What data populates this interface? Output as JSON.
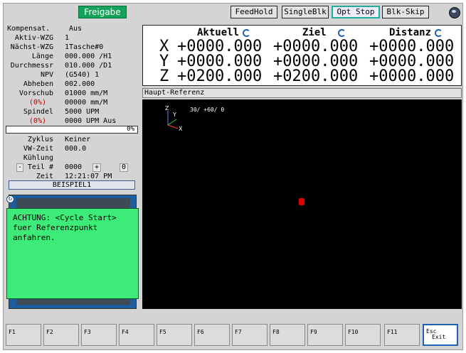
{
  "topbar": {
    "enable_label": "Freigabe",
    "buttons": [
      {
        "label": "FeedHold",
        "active": false
      },
      {
        "label": "SingleBlk",
        "active": false
      },
      {
        "label": "Opt Stop",
        "active": true
      },
      {
        "label": "Blk-Skip",
        "active": false
      }
    ]
  },
  "status": {
    "rows": [
      {
        "label": "Kompensat.",
        "value": "Aus"
      },
      {
        "label": "Aktiv-WZG",
        "value": "1"
      },
      {
        "label": "Nächst-WZG",
        "value": "1Tasche#0"
      },
      {
        "label": "Länge",
        "value": "000.000 /H1"
      },
      {
        "label": "Durchmessr",
        "value": "010.000 /D1"
      },
      {
        "label": "NPV",
        "value": "(G540) 1"
      },
      {
        "label": "Abheben",
        "value": "002.000"
      },
      {
        "label": "Vorschub",
        "value": "01000 mm/M"
      },
      {
        "label": "(0%)",
        "value": "00000 mm/M"
      },
      {
        "label": "Spindel",
        "value": "5000 UPM"
      },
      {
        "label": "(0%)",
        "value": "0000 UPM Aus"
      }
    ],
    "progress": "0%",
    "cycle_label": "Zyklus",
    "cycle_value": "Keiner",
    "dwell_label": "VW-Zeit",
    "dwell_value": "000.0",
    "coolant_label": "Kühlung",
    "part_minus": "-",
    "part_label": "Teil #",
    "part_value": "0000",
    "part_plus": "+",
    "part_reset": "0",
    "time_label": "Zeit",
    "time_value": "12:21:07 PM",
    "program_name": "BEISPIEL1"
  },
  "warning": "ACHTUNG: <Cycle Start> fuer Referenzpunkt anfahren.",
  "dro": {
    "headers": [
      "Aktuell",
      "Ziel",
      "Distanz"
    ],
    "axes": [
      {
        "name": "X",
        "actual": "+0000.000",
        "target": "+0000.000",
        "distance": "+0000.000"
      },
      {
        "name": "Y",
        "actual": "+0000.000",
        "target": "+0000.000",
        "distance": "+0000.000"
      },
      {
        "name": "Z",
        "actual": "+0200.000",
        "target": "+0200.000",
        "distance": "+0000.000"
      }
    ]
  },
  "preview": {
    "title": "Haupt-Referenz",
    "view_angles": "30/ +60/ 0",
    "axis_labels": {
      "z": "Z",
      "y": "Y",
      "x": "X"
    }
  },
  "fkeys": [
    "F1",
    "F2",
    "F3",
    "F4",
    "F5",
    "F6",
    "F7",
    "F8",
    "F9",
    "F10",
    "F11"
  ],
  "exit_key": {
    "top": "Esc",
    "bottom": "Exit"
  },
  "colors": {
    "enable": "#13a35a",
    "warning": "#3deb78",
    "tool_marker": "#e00000",
    "accent": "#1f62b5"
  }
}
